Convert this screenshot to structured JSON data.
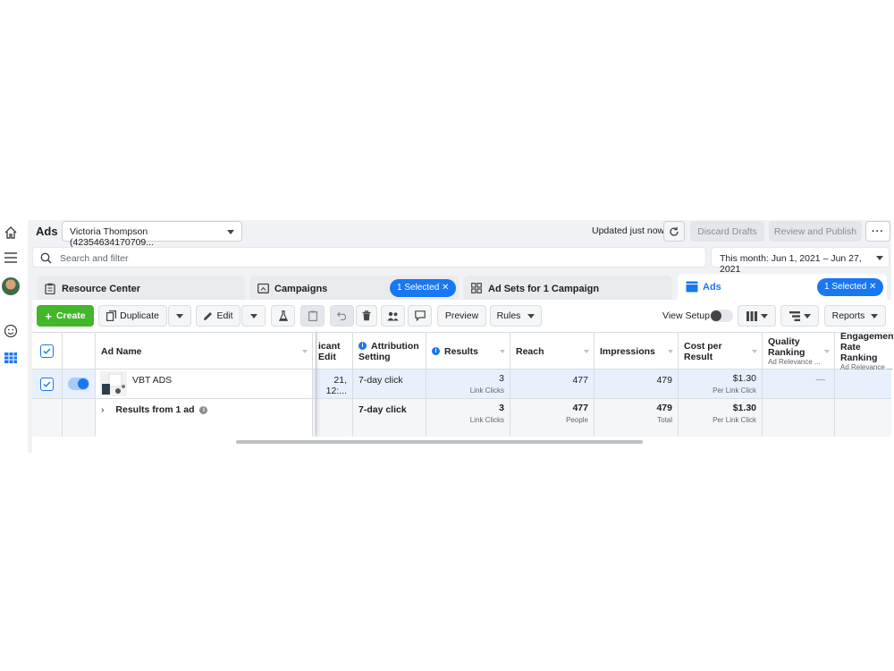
{
  "header": {
    "title": "Ads",
    "account": "Victoria Thompson (42354634170709...",
    "updated": "Updated just now",
    "discard_drafts": "Discard Drafts",
    "review_publish": "Review and Publish",
    "more": "···"
  },
  "search": {
    "placeholder": "Search and filter"
  },
  "date_range": "This month: Jun 1, 2021 – Jun 27, 2021",
  "tabs": [
    {
      "label": "Resource Center"
    },
    {
      "label": "Campaigns",
      "badge": "1 Selected"
    },
    {
      "label": "Ad Sets for 1 Campaign"
    },
    {
      "label": "Ads",
      "badge": "1 Selected"
    }
  ],
  "toolbar": {
    "create": "Create",
    "duplicate": "Duplicate",
    "edit": "Edit",
    "preview": "Preview",
    "rules": "Rules",
    "view_setup": "View Setup",
    "reports": "Reports"
  },
  "columns": {
    "ad_name": "Ad Name",
    "last_edit": "icant Edit",
    "attribution": "Attribution Setting",
    "results": "Results",
    "reach": "Reach",
    "impressions": "Impressions",
    "cost": "Cost per Result",
    "quality": "Quality Ranking",
    "quality_sub": "Ad Relevance ...",
    "engagement": "Engagement Rate Ranking",
    "engagement_sub": "Ad Relevance ..."
  },
  "rows": [
    {
      "name": "VBT ADS",
      "last_edit": "21, 12:...",
      "attribution": "7-day click",
      "results": "3",
      "results_unit": "Link Clicks",
      "reach": "477",
      "impressions": "479",
      "cost": "$1.30",
      "cost_unit": "Per Link Click",
      "quality": "—"
    }
  ],
  "summary": {
    "label": "Results from 1 ad",
    "attribution": "7-day click",
    "results": "3",
    "results_unit": "Link Clicks",
    "reach": "477",
    "reach_unit": "People",
    "impressions": "479",
    "impressions_unit": "Total",
    "cost": "$1.30",
    "cost_unit": "Per Link Click"
  },
  "colors": {
    "accent": "#1877f2",
    "create_green": "#42b72a",
    "selected_row": "#e7f0fc"
  }
}
